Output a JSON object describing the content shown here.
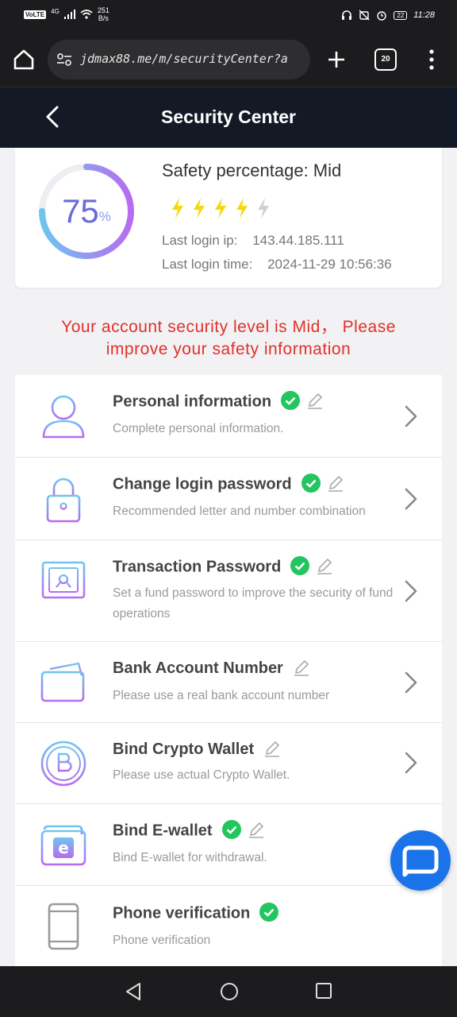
{
  "status_bar": {
    "carrier_badge": "VoLTE",
    "signal_label": "4G",
    "net_speed": "251",
    "net_speed_unit": "B/s",
    "battery": "22",
    "time": "11:28"
  },
  "browser": {
    "url": "jdmax88.me/m/securityCenter?a",
    "tab_count": "20"
  },
  "header": {
    "title": "Security Center"
  },
  "safety": {
    "percent_value": "75",
    "percent_sign": "%",
    "percent_fraction": 0.75,
    "title": "Safety percentage: Mid",
    "bolts_filled": 4,
    "bolts_total": 5,
    "last_ip_label": "Last login ip:",
    "last_ip_value": "143.44.185.111",
    "last_time_label": "Last login time:",
    "last_time_value": "2024-11-29 10:56:36"
  },
  "warning": {
    "line1": "Your account security level is Mid， Please",
    "line2": "improve your safety information"
  },
  "menu": {
    "items": [
      {
        "title": "Personal information",
        "desc": "Complete personal information.",
        "verified": true,
        "icon": "person-icon"
      },
      {
        "title": "Change login password",
        "desc": "Recommended letter and number combination",
        "verified": true,
        "icon": "padlock-icon"
      },
      {
        "title": "Transaction Password",
        "desc": "Set a fund password to improve the security of fund operations",
        "verified": true,
        "icon": "safe-icon"
      },
      {
        "title": "Bank Account Number",
        "desc": "Please use a real bank account number",
        "verified": false,
        "icon": "bank-card-icon"
      },
      {
        "title": "Bind Crypto Wallet",
        "desc": "Please use actual Crypto Wallet.",
        "verified": false,
        "icon": "bitcoin-icon"
      },
      {
        "title": "Bind E-wallet",
        "desc": "Bind E-wallet for withdrawal.",
        "verified": true,
        "icon": "ewallet-icon"
      },
      {
        "title": "Phone verification",
        "desc": "Phone verification",
        "verified": true,
        "icon": "phone-icon"
      }
    ]
  },
  "colors": {
    "header_bg": "#131a26",
    "warning_red": "#e0312b",
    "verified_green": "#22c55e",
    "bolt_yellow": "#f5d90a",
    "chat_blue": "#1a73e8"
  }
}
